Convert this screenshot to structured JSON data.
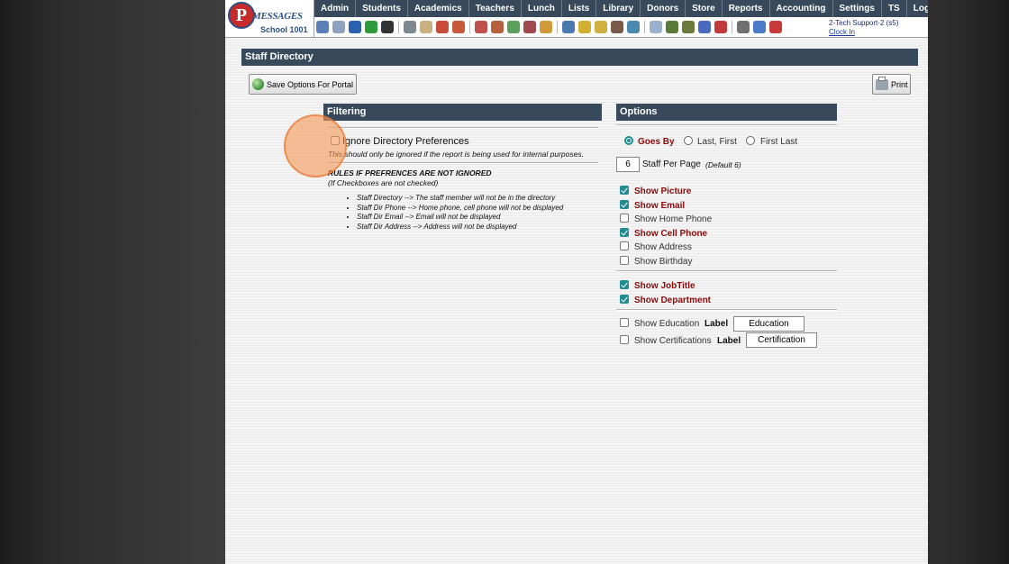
{
  "logo": {
    "initial": "P",
    "brand": "MESSAGES",
    "school": "School 1001"
  },
  "menu": [
    "Admin",
    "Students",
    "Academics",
    "Teachers",
    "Lunch",
    "Lists",
    "Library",
    "Donors",
    "Store",
    "Reports",
    "Accounting",
    "Settings",
    "TS",
    "Logout"
  ],
  "toolbar_icons": [
    {
      "name": "search-icon",
      "color": "#5b7fb8"
    },
    {
      "name": "grid-icon",
      "color": "#8fa3c0"
    },
    {
      "name": "email-icon",
      "color": "#2b5fb0"
    },
    {
      "name": "chat-icon",
      "color": "#2f9a3a"
    },
    {
      "name": "phone-icon",
      "color": "#333333"
    },
    {
      "name": "speaker-icon",
      "color": "#7f8790"
    },
    {
      "name": "form-icon",
      "color": "#c8b080"
    },
    {
      "name": "calendar-icon",
      "color": "#c84a3a"
    },
    {
      "name": "megaphone-icon",
      "color": "#c8583a"
    },
    {
      "name": "teacher-icon",
      "color": "#c0504a"
    },
    {
      "name": "staff-icon",
      "color": "#b8603a"
    },
    {
      "name": "ticket-icon",
      "color": "#5aa05a"
    },
    {
      "name": "people-icon",
      "color": "#a04a50"
    },
    {
      "name": "lunch-icon",
      "color": "#d09a3a"
    },
    {
      "name": "book-icon",
      "color": "#4a7ab0"
    },
    {
      "name": "pencil-icon",
      "color": "#d0b030"
    },
    {
      "name": "hand-icon",
      "color": "#d0b040"
    },
    {
      "name": "user-icon",
      "color": "#7a5a4a"
    },
    {
      "name": "clock-icon",
      "color": "#4a8ab0"
    },
    {
      "name": "table-icon",
      "color": "#9ab0d0"
    },
    {
      "name": "card-icon",
      "color": "#5a7a3a"
    },
    {
      "name": "register-icon",
      "color": "#6a7a3a"
    },
    {
      "name": "apps-icon",
      "color": "#4a6ac0"
    },
    {
      "name": "pdf-icon",
      "color": "#c03a3a"
    },
    {
      "name": "printer-icon",
      "color": "#707070"
    },
    {
      "name": "help-icon",
      "color": "#4a7ac8"
    },
    {
      "name": "power-icon",
      "color": "#c83a3a"
    }
  ],
  "user": {
    "name": "2-Tech Support-2 (s5)",
    "clock": "Clock In"
  },
  "page_title": "Staff Directory",
  "buttons": {
    "save": "Save Options For Portal",
    "print": "Print"
  },
  "filtering": {
    "header": "Filtering",
    "ignore_label": "Ignore Directory Preferences",
    "ignore_note": "This should only be ignored if the report is being used for internal purposes.",
    "rules_title": "RULES IF PREFRENCES ARE NOT IGNORED",
    "rules_sub": "(If Checkboxes are not checked)",
    "rules": [
      "Staff Directory --> The staff member will not be in the directory",
      "Staff Dir Phone --> Home phone, cell phone will not be displayed",
      "Staff Dir Email --> Email will not be displayed",
      "Staff Dir Address --> Address will not be displayed"
    ]
  },
  "options": {
    "header": "Options",
    "radios": [
      "Goes By",
      "Last, First",
      "First Last"
    ],
    "per_page_value": "6",
    "per_page_label": "Staff Per Page",
    "per_page_default": "(Default 6)",
    "checks": [
      {
        "label": "Show Picture",
        "checked": true
      },
      {
        "label": "Show Email",
        "checked": true
      },
      {
        "label": "Show Home Phone",
        "checked": false
      },
      {
        "label": "Show Cell Phone",
        "checked": true
      },
      {
        "label": "Show Address",
        "checked": false
      },
      {
        "label": "Show Birthday",
        "checked": false
      }
    ],
    "checks2": [
      {
        "label": "Show JobTitle",
        "checked": true
      },
      {
        "label": "Show Department",
        "checked": true
      }
    ],
    "education_label": "Show Education",
    "education_value": "Education",
    "cert_label": "Show Certifications",
    "cert_value": "Certification",
    "label_word": "Label"
  }
}
